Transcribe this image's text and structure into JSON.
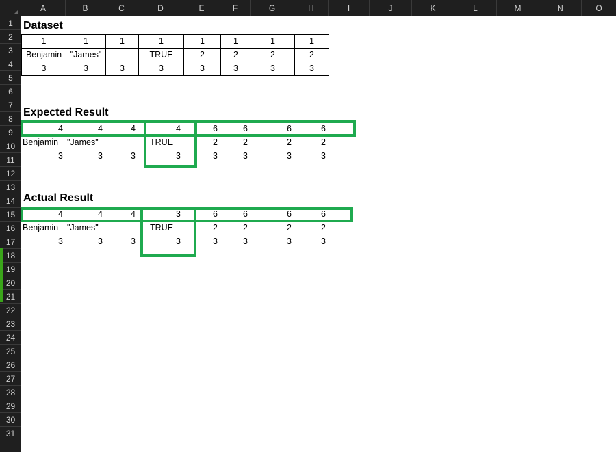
{
  "columns": [
    "A",
    "B",
    "C",
    "D",
    "E",
    "F",
    "G",
    "H",
    "I",
    "J",
    "K",
    "L",
    "M",
    "N",
    "O"
  ],
  "rows": [
    "1",
    "2",
    "3",
    "4",
    "5",
    "6",
    "7",
    "8",
    "9",
    "10",
    "11",
    "12",
    "13",
    "14",
    "15",
    "16",
    "17",
    "18",
    "19",
    "20",
    "21",
    "22",
    "23",
    "24",
    "25",
    "26",
    "27",
    "28",
    "29",
    "30",
    "31"
  ],
  "dataset": {
    "title": "Dataset",
    "row2": [
      "1",
      "1",
      "1",
      "1",
      "1",
      "1",
      "1",
      "1"
    ],
    "row3": [
      "Benjamin",
      "\"James\"",
      "",
      "TRUE",
      "2",
      "2",
      "2",
      "2"
    ],
    "row4": [
      "3",
      "3",
      "3",
      "3",
      "3",
      "3",
      "3",
      "3"
    ]
  },
  "expected": {
    "title": "Expected Result",
    "row8": [
      "4",
      "4",
      "4",
      "4",
      "6",
      "6",
      "6",
      "6"
    ],
    "row9": [
      "Benjamin",
      "\"James\"",
      "",
      "TRUE",
      "2",
      "2",
      "2",
      "2"
    ],
    "row10": [
      "3",
      "3",
      "3",
      "3",
      "3",
      "3",
      "3",
      "3"
    ]
  },
  "actual": {
    "title": "Actual Result",
    "row14": [
      "4",
      "4",
      "4",
      "3",
      "6",
      "6",
      "6",
      "6"
    ],
    "row15": [
      "Benjamin",
      "\"James\"",
      "",
      "TRUE",
      "2",
      "2",
      "2",
      "2"
    ],
    "row16": [
      "3",
      "3",
      "3",
      "3",
      "3",
      "3",
      "3",
      "3"
    ]
  },
  "colors": {
    "highlight": "#1faa4f",
    "header_bg": "#1f1f1f",
    "header_text": "#cfcfcf"
  }
}
